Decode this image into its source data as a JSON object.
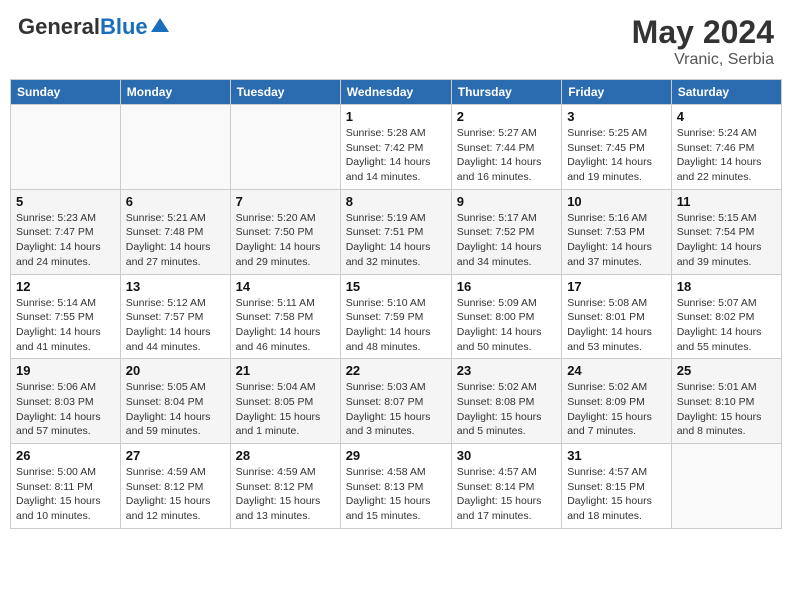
{
  "header": {
    "logo_general": "General",
    "logo_blue": "Blue",
    "month_year": "May 2024",
    "location": "Vranic, Serbia"
  },
  "days_of_week": [
    "Sunday",
    "Monday",
    "Tuesday",
    "Wednesday",
    "Thursday",
    "Friday",
    "Saturday"
  ],
  "weeks": [
    [
      {
        "day": "",
        "info": ""
      },
      {
        "day": "",
        "info": ""
      },
      {
        "day": "",
        "info": ""
      },
      {
        "day": "1",
        "info": "Sunrise: 5:28 AM\nSunset: 7:42 PM\nDaylight: 14 hours\nand 14 minutes."
      },
      {
        "day": "2",
        "info": "Sunrise: 5:27 AM\nSunset: 7:44 PM\nDaylight: 14 hours\nand 16 minutes."
      },
      {
        "day": "3",
        "info": "Sunrise: 5:25 AM\nSunset: 7:45 PM\nDaylight: 14 hours\nand 19 minutes."
      },
      {
        "day": "4",
        "info": "Sunrise: 5:24 AM\nSunset: 7:46 PM\nDaylight: 14 hours\nand 22 minutes."
      }
    ],
    [
      {
        "day": "5",
        "info": "Sunrise: 5:23 AM\nSunset: 7:47 PM\nDaylight: 14 hours\nand 24 minutes."
      },
      {
        "day": "6",
        "info": "Sunrise: 5:21 AM\nSunset: 7:48 PM\nDaylight: 14 hours\nand 27 minutes."
      },
      {
        "day": "7",
        "info": "Sunrise: 5:20 AM\nSunset: 7:50 PM\nDaylight: 14 hours\nand 29 minutes."
      },
      {
        "day": "8",
        "info": "Sunrise: 5:19 AM\nSunset: 7:51 PM\nDaylight: 14 hours\nand 32 minutes."
      },
      {
        "day": "9",
        "info": "Sunrise: 5:17 AM\nSunset: 7:52 PM\nDaylight: 14 hours\nand 34 minutes."
      },
      {
        "day": "10",
        "info": "Sunrise: 5:16 AM\nSunset: 7:53 PM\nDaylight: 14 hours\nand 37 minutes."
      },
      {
        "day": "11",
        "info": "Sunrise: 5:15 AM\nSunset: 7:54 PM\nDaylight: 14 hours\nand 39 minutes."
      }
    ],
    [
      {
        "day": "12",
        "info": "Sunrise: 5:14 AM\nSunset: 7:55 PM\nDaylight: 14 hours\nand 41 minutes."
      },
      {
        "day": "13",
        "info": "Sunrise: 5:12 AM\nSunset: 7:57 PM\nDaylight: 14 hours\nand 44 minutes."
      },
      {
        "day": "14",
        "info": "Sunrise: 5:11 AM\nSunset: 7:58 PM\nDaylight: 14 hours\nand 46 minutes."
      },
      {
        "day": "15",
        "info": "Sunrise: 5:10 AM\nSunset: 7:59 PM\nDaylight: 14 hours\nand 48 minutes."
      },
      {
        "day": "16",
        "info": "Sunrise: 5:09 AM\nSunset: 8:00 PM\nDaylight: 14 hours\nand 50 minutes."
      },
      {
        "day": "17",
        "info": "Sunrise: 5:08 AM\nSunset: 8:01 PM\nDaylight: 14 hours\nand 53 minutes."
      },
      {
        "day": "18",
        "info": "Sunrise: 5:07 AM\nSunset: 8:02 PM\nDaylight: 14 hours\nand 55 minutes."
      }
    ],
    [
      {
        "day": "19",
        "info": "Sunrise: 5:06 AM\nSunset: 8:03 PM\nDaylight: 14 hours\nand 57 minutes."
      },
      {
        "day": "20",
        "info": "Sunrise: 5:05 AM\nSunset: 8:04 PM\nDaylight: 14 hours\nand 59 minutes."
      },
      {
        "day": "21",
        "info": "Sunrise: 5:04 AM\nSunset: 8:05 PM\nDaylight: 15 hours\nand 1 minute."
      },
      {
        "day": "22",
        "info": "Sunrise: 5:03 AM\nSunset: 8:07 PM\nDaylight: 15 hours\nand 3 minutes."
      },
      {
        "day": "23",
        "info": "Sunrise: 5:02 AM\nSunset: 8:08 PM\nDaylight: 15 hours\nand 5 minutes."
      },
      {
        "day": "24",
        "info": "Sunrise: 5:02 AM\nSunset: 8:09 PM\nDaylight: 15 hours\nand 7 minutes."
      },
      {
        "day": "25",
        "info": "Sunrise: 5:01 AM\nSunset: 8:10 PM\nDaylight: 15 hours\nand 8 minutes."
      }
    ],
    [
      {
        "day": "26",
        "info": "Sunrise: 5:00 AM\nSunset: 8:11 PM\nDaylight: 15 hours\nand 10 minutes."
      },
      {
        "day": "27",
        "info": "Sunrise: 4:59 AM\nSunset: 8:12 PM\nDaylight: 15 hours\nand 12 minutes."
      },
      {
        "day": "28",
        "info": "Sunrise: 4:59 AM\nSunset: 8:12 PM\nDaylight: 15 hours\nand 13 minutes."
      },
      {
        "day": "29",
        "info": "Sunrise: 4:58 AM\nSunset: 8:13 PM\nDaylight: 15 hours\nand 15 minutes."
      },
      {
        "day": "30",
        "info": "Sunrise: 4:57 AM\nSunset: 8:14 PM\nDaylight: 15 hours\nand 17 minutes."
      },
      {
        "day": "31",
        "info": "Sunrise: 4:57 AM\nSunset: 8:15 PM\nDaylight: 15 hours\nand 18 minutes."
      },
      {
        "day": "",
        "info": ""
      }
    ]
  ]
}
